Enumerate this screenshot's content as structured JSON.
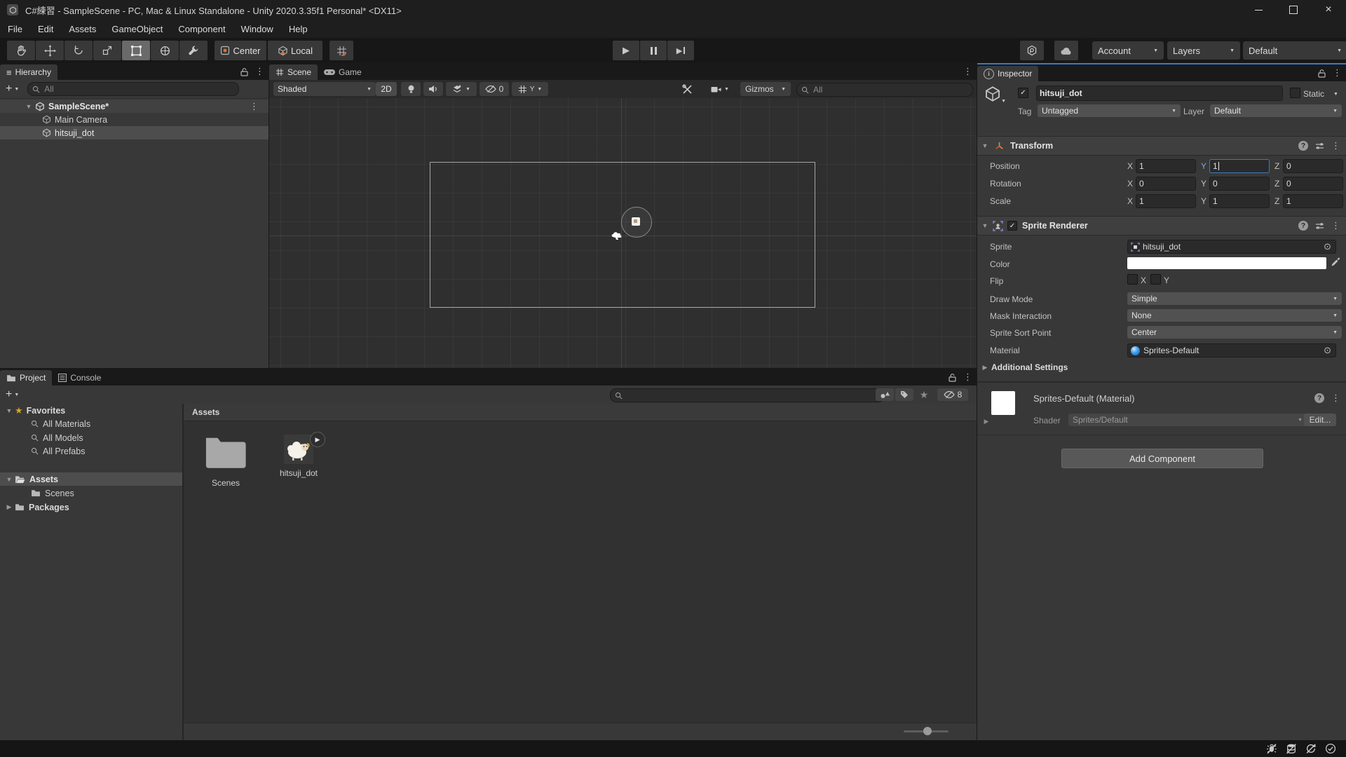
{
  "window": {
    "title": "C#練習 - SampleScene - PC, Mac & Linux Standalone - Unity 2020.3.35f1 Personal* <DX11>"
  },
  "menu": {
    "items": [
      "File",
      "Edit",
      "Assets",
      "GameObject",
      "Component",
      "Window",
      "Help"
    ]
  },
  "toolbar": {
    "pivot_label": "Center",
    "orientation_label": "Local",
    "account_label": "Account",
    "layers_label": "Layers",
    "layout_label": "Default"
  },
  "hierarchy": {
    "tab_label": "Hierarchy",
    "search_placeholder": "All",
    "scene_row": "SampleScene*",
    "items": [
      {
        "label": "Main Camera"
      },
      {
        "label": "hitsuji_dot"
      }
    ]
  },
  "scene_view": {
    "tab_scene": "Scene",
    "tab_game": "Game",
    "shading_mode": "Shaded",
    "mode_2d": "2D",
    "hidden_count": "0",
    "grid_axis": "Y",
    "gizmos_label": "Gizmos",
    "search_placeholder": "All"
  },
  "project": {
    "tab_project": "Project",
    "tab_console": "Console",
    "favorites_label": "Favorites",
    "favorites": [
      "All Materials",
      "All Models",
      "All Prefabs"
    ],
    "assets_label": "Assets",
    "scenes_label": "Scenes",
    "packages_label": "Packages",
    "content_header": "Assets",
    "items": [
      {
        "label": "Scenes"
      },
      {
        "label": "hitsuji_dot"
      }
    ],
    "hidden_count": "8"
  },
  "inspector": {
    "tab_label": "Inspector",
    "object_name": "hitsuji_dot",
    "static_label": "Static",
    "tag_label": "Tag",
    "tag_value": "Untagged",
    "layer_label": "Layer",
    "layer_value": "Default",
    "transform": {
      "title": "Transform",
      "axis": {
        "x": "X",
        "y": "Y",
        "z": "Z"
      },
      "rows": [
        {
          "label": "Position",
          "x": "1",
          "y": "1",
          "z": "0"
        },
        {
          "label": "Rotation",
          "x": "0",
          "y": "0",
          "z": "0"
        },
        {
          "label": "Scale",
          "x": "1",
          "y": "1",
          "z": "1"
        }
      ]
    },
    "sprite_renderer": {
      "title": "Sprite Renderer",
      "sprite_label": "Sprite",
      "sprite_value": "hitsuji_dot",
      "color_label": "Color",
      "flip_label": "Flip",
      "flip_x": "X",
      "flip_y": "Y",
      "draw_mode_label": "Draw Mode",
      "draw_mode_value": "Simple",
      "mask_label": "Mask Interaction",
      "mask_value": "None",
      "sort_point_label": "Sprite Sort Point",
      "sort_point_value": "Center",
      "material_label": "Material",
      "material_value": "Sprites-Default",
      "additional_label": "Additional Settings"
    },
    "material_section": {
      "title": "Sprites-Default (Material)",
      "shader_label": "Shader",
      "shader_value": "Sprites/Default",
      "edit_label": "Edit..."
    },
    "add_component_label": "Add Component"
  },
  "icons": {
    "kebab": "⋮",
    "hamburger": "≡",
    "star": "★",
    "caret": "▼",
    "foldout_open": "▼",
    "foldout_closed": "▶",
    "check": "✓",
    "target": "⊙",
    "play": "▶",
    "plus": "+",
    "close": "×",
    "minimize": "–",
    "info": "i"
  },
  "colors": {
    "focus_blue": "#3c7bbf",
    "axis_y_active": "#7aa9d8",
    "selection_row": "#4d4d4d",
    "scene_row": "#414141",
    "star_yellow": "#d7a420"
  }
}
